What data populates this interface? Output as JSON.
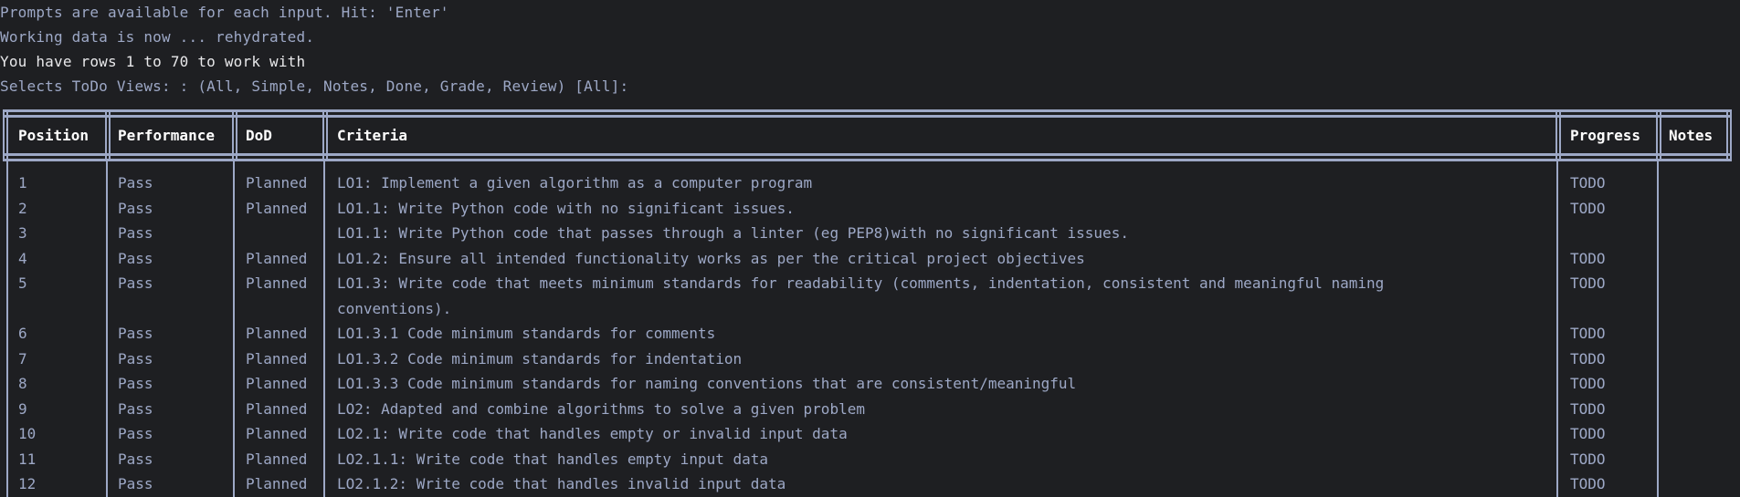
{
  "console": {
    "prompt_line": "Prompts are available for each input. Hit: 'Enter'",
    "status_line": "Working data is now ... rehydrated.",
    "rows_line": "You have rows 1 to 70 to work with",
    "views_line": "Selects ToDo Views: : (All, Simple, Notes, Done, Grade, Review) [All]:"
  },
  "table": {
    "headers": [
      "Position",
      "Performance",
      "DoD",
      "Criteria",
      "Progress",
      "Notes"
    ],
    "rows": [
      {
        "position": "1",
        "performance": "Pass",
        "dod": "Planned",
        "criteria": "LO1: Implement a given algorithm as a computer program",
        "progress": "TODO",
        "notes": ""
      },
      {
        "position": "2",
        "performance": "Pass",
        "dod": "Planned",
        "criteria": "LO1.1: Write Python code with no significant issues.",
        "progress": "TODO",
        "notes": ""
      },
      {
        "position": "3",
        "performance": "Pass",
        "dod": "",
        "criteria": "LO1.1: Write Python code that passes through a linter (eg PEP8)with no significant issues.",
        "progress": "",
        "notes": ""
      },
      {
        "position": "4",
        "performance": "Pass",
        "dod": "Planned",
        "criteria": "LO1.2: Ensure all intended functionality works as per the critical project objectives",
        "progress": "TODO",
        "notes": ""
      },
      {
        "position": "5",
        "performance": "Pass",
        "dod": "Planned",
        "criteria": "LO1.3: Write code that meets minimum standards for readability (comments, indentation, consistent and meaningful naming",
        "progress": "TODO",
        "notes": ""
      },
      {
        "position": "",
        "performance": "",
        "dod": "",
        "criteria": "conventions).",
        "progress": "",
        "notes": ""
      },
      {
        "position": "6",
        "performance": "Pass",
        "dod": "Planned",
        "criteria": "LO1.3.1 Code minimum standards for comments",
        "progress": "TODO",
        "notes": ""
      },
      {
        "position": "7",
        "performance": "Pass",
        "dod": "Planned",
        "criteria": "LO1.3.2 Code minimum standards for indentation",
        "progress": "TODO",
        "notes": ""
      },
      {
        "position": "8",
        "performance": "Pass",
        "dod": "Planned",
        "criteria": "LO1.3.3 Code minimum standards for naming conventions that are consistent/meaningful",
        "progress": "TODO",
        "notes": ""
      },
      {
        "position": "9",
        "performance": "Pass",
        "dod": "Planned",
        "criteria": "LO2: Adapted and combine algorithms to solve a given problem",
        "progress": "TODO",
        "notes": ""
      },
      {
        "position": "10",
        "performance": "Pass",
        "dod": "Planned",
        "criteria": "LO2.1: Write code that handles empty or invalid input data",
        "progress": "TODO",
        "notes": ""
      },
      {
        "position": "11",
        "performance": "Pass",
        "dod": "Planned",
        "criteria": "LO2.1.1: Write code that handles empty input data",
        "progress": "TODO",
        "notes": ""
      },
      {
        "position": "12",
        "performance": "Pass",
        "dod": "Planned",
        "criteria": "LO2.1.2: Write code that handles invalid input data",
        "progress": "TODO",
        "notes": ""
      }
    ]
  }
}
